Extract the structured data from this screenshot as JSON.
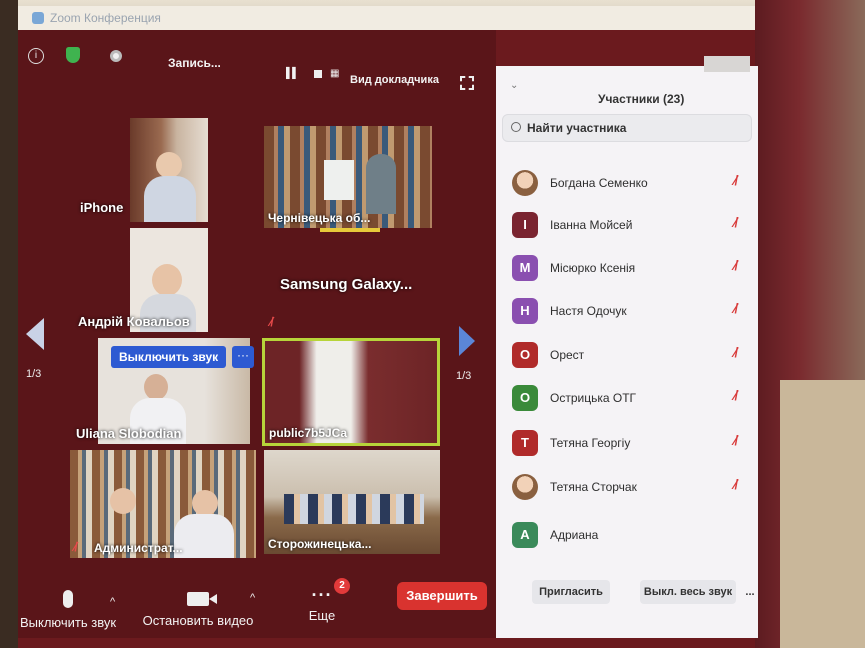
{
  "window": {
    "title": "Zoom Конференция"
  },
  "topbar": {
    "recording_label": "Запись...",
    "view_label": "Вид докладчика"
  },
  "tiles": [
    {
      "name": "iPhone"
    },
    {
      "name": "Чернівецька об..."
    },
    {
      "name": "Андрій Ковальов"
    },
    {
      "name": "Samsung  Galaxy..."
    },
    {
      "name": "Uliana Slobodian"
    },
    {
      "name": "public7b5JCa"
    },
    {
      "name": "Администрат..."
    },
    {
      "name": "Сторожинецька..."
    }
  ],
  "hover_controls": {
    "mute_label": "Выключить звук",
    "more_label": "···"
  },
  "paging": {
    "left": "1/3",
    "right": "1/3"
  },
  "bottombar": {
    "mute_label": "Выключить звук",
    "video_label": "Остановить видео",
    "more_label": "Еще",
    "more_badge": "2",
    "end_label": "Завершить"
  },
  "panel": {
    "title": "Участники (23)",
    "search_placeholder": "Найти участника",
    "participants": [
      {
        "name": "Богдана Семенко",
        "initial": "",
        "color": "",
        "muted": true
      },
      {
        "name": "Іванна Мойсей",
        "initial": "І",
        "color": "#7a2430",
        "muted": true
      },
      {
        "name": "Місюрко Ксенія",
        "initial": "М",
        "color": "#8a4fb0",
        "muted": true
      },
      {
        "name": "Настя Одочук",
        "initial": "Н",
        "color": "#8a4fb0",
        "muted": true
      },
      {
        "name": "Орест",
        "initial": "О",
        "color": "#b02a2a",
        "muted": true
      },
      {
        "name": "Острицька ОТГ",
        "initial": "О",
        "color": "#3a8a3a",
        "muted": true
      },
      {
        "name": "Тетяна Георгіу",
        "initial": "Т",
        "color": "#b02a2a",
        "muted": true
      },
      {
        "name": "Тетяна Сторчак",
        "initial": "",
        "color": "",
        "muted": true
      },
      {
        "name": "Адриана",
        "initial": "А",
        "color": "#3a8a5a",
        "muted": false
      }
    ],
    "invite_label": "Пригласить",
    "mute_all_label": "Выкл. весь звук",
    "more_label": "..."
  },
  "icons": {
    "mute": "mic-off-icon"
  }
}
